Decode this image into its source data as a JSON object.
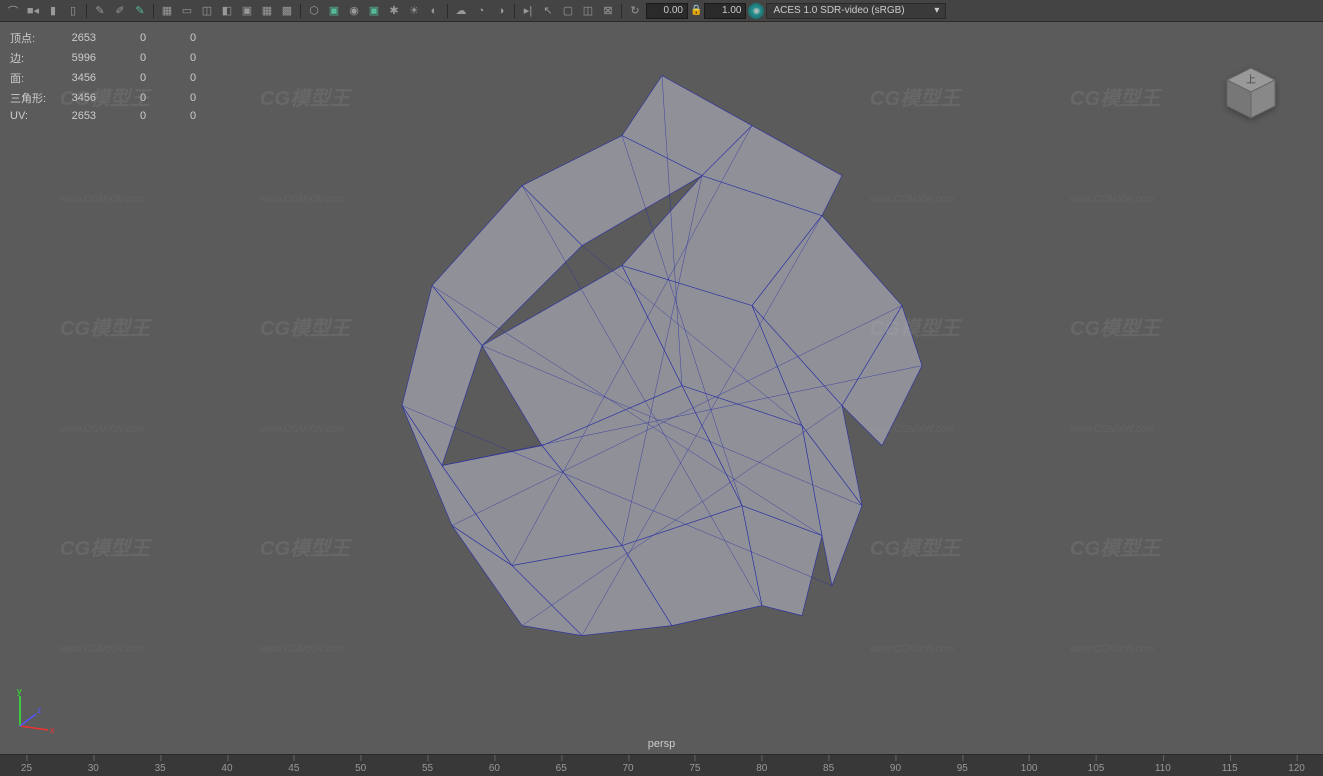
{
  "toolbar": {
    "val1": "0.00",
    "val2": "1.00",
    "colorspace": "ACES 1.0 SDR-video (sRGB)"
  },
  "hud": {
    "rows": [
      {
        "label": "顶点:",
        "v1": "2653",
        "v2": "0",
        "v3": "0"
      },
      {
        "label": "边:",
        "v1": "5996",
        "v2": "0",
        "v3": "0"
      },
      {
        "label": "面:",
        "v1": "3456",
        "v2": "0",
        "v3": "0"
      },
      {
        "label": "三角形:",
        "v1": "3456",
        "v2": "0",
        "v3": "0"
      },
      {
        "label": "UV:",
        "v1": "2653",
        "v2": "0",
        "v3": "0"
      }
    ]
  },
  "camera": "persp",
  "viewcube_label": "上",
  "timeline": {
    "ticks": [
      "25",
      "30",
      "35",
      "40",
      "45",
      "50",
      "55",
      "60",
      "65",
      "70",
      "75",
      "80",
      "85",
      "90",
      "95",
      "100",
      "105",
      "110",
      "115",
      "120"
    ]
  },
  "watermark": "CG模型王",
  "watermark_url": "www.CGMXW.com"
}
